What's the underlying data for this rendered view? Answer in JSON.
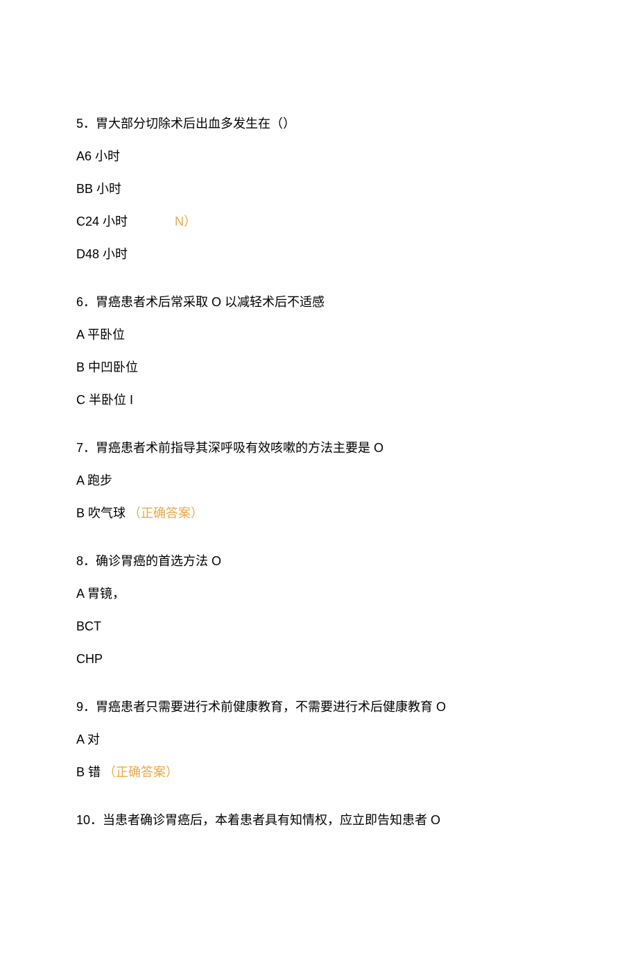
{
  "questions": [
    {
      "number": "5",
      "text": "．胃大部分切除术后出血多发生在（）",
      "options": [
        {
          "label": "A6 小时",
          "correct": null
        },
        {
          "label": "BB 小时",
          "correct": null
        },
        {
          "label": "C24 小时",
          "correct": "N）",
          "correct_style": "spaced"
        },
        {
          "label": "D48 小时",
          "correct": null
        }
      ]
    },
    {
      "number": "6",
      "text": "．胃癌患者术后常采取 O 以减轻术后不适感",
      "options": [
        {
          "label": "A 平卧位",
          "correct": null
        },
        {
          "label": "B 中凹卧位",
          "correct": null
        },
        {
          "label": "C 半卧位 I",
          "correct": null
        }
      ]
    },
    {
      "number": "7",
      "text": "．胃癌患者术前指导其深呼吸有效咳嗽的方法主要是 O",
      "options": [
        {
          "label": "A 跑步",
          "correct": null
        },
        {
          "label": "B 吹气球",
          "correct": "（正确答案）",
          "correct_style": "inline"
        }
      ]
    },
    {
      "number": "8",
      "text": "．确诊胃癌的首选方法 O",
      "options": [
        {
          "label": "A 胃镜，",
          "correct": null
        },
        {
          "label": "BCT",
          "correct": null
        },
        {
          "label": "CHP",
          "correct": null
        }
      ]
    },
    {
      "number": "9",
      "text": "．胃癌患者只需要进行术前健康教育，不需要进行术后健康教育 O",
      "options": [
        {
          "label": "A 对",
          "correct": null
        },
        {
          "label": "B 错",
          "correct": "（正确答案）",
          "correct_style": "inline"
        }
      ]
    },
    {
      "number": "10",
      "text": "．当患者确诊胃癌后，本着患者具有知情权，应立即告知患者 O",
      "options": []
    }
  ]
}
